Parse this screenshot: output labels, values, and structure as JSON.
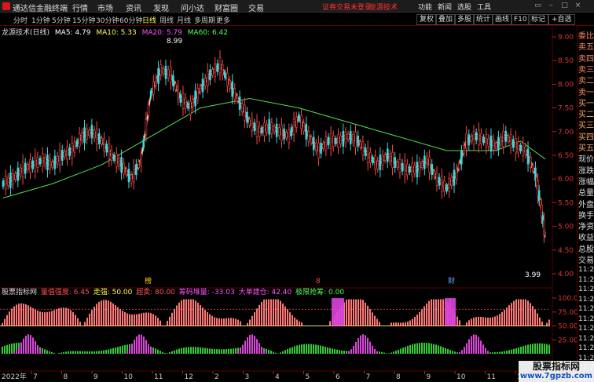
{
  "menu": {
    "app_title": "通达信金融终端",
    "items": [
      "行情",
      "市场",
      "资讯",
      "发现",
      "问小达",
      "财富圈",
      "交易"
    ],
    "login_status": "证券交易未登录",
    "brand_link": "龙源技术",
    "tools": [
      "功能",
      "新闻",
      "选股",
      "工具"
    ]
  },
  "periods": [
    "分时",
    "1分钟",
    "5分钟",
    "15分钟",
    "30分钟",
    "60分钟",
    "日线",
    "周线",
    "月线",
    "多周期",
    "更多"
  ],
  "active_period": "日线",
  "right_buttons": [
    "复权",
    "叠加",
    "多股",
    "统计",
    "画线",
    "F10",
    "标记",
    "+自选"
  ],
  "chart": {
    "stock_name": "龙源技术(日线)",
    "ma": [
      {
        "label": "MA5: 4.79",
        "color": "#ffffff"
      },
      {
        "label": "MA10: 5.33",
        "color": "#ffff55"
      },
      {
        "label": "MA20: 5.79",
        "color": "#ff55ff"
      },
      {
        "label": "MA60: 6.42",
        "color": "#55ff55"
      }
    ],
    "high_label": "8.99",
    "low_label": "3.99",
    "markers": [
      {
        "text": "榜",
        "color": "#ffcc00"
      },
      {
        "text": "8",
        "color": "#ff4444"
      },
      {
        "text": "财",
        "color": "#66aaff"
      }
    ],
    "year_label": "2022年"
  },
  "indicator": {
    "name": "股票指标网",
    "items": [
      {
        "label": "量值强度: 6.45",
        "color": "#ff5555"
      },
      {
        "label": "走强: 50.00",
        "color": "#ffff55"
      },
      {
        "label": "超卖: 80.00",
        "color": "#ff5555"
      },
      {
        "label": "筹码堆量: -33.03",
        "color": "#ff55ff"
      },
      {
        "label": "大单建仓: 42.40",
        "color": "#ff55ff"
      },
      {
        "label": "极限抢筹: 0.00",
        "color": "#55ff55"
      }
    ],
    "ticks": [
      "100.0",
      "75.00",
      "50.00",
      "25.00"
    ]
  },
  "side_panel": {
    "labels": [
      "委比",
      "卖五",
      "卖四",
      "卖三",
      "卖二",
      "卖一",
      "买一",
      "买二",
      "买三",
      "买四",
      "买五",
      "现价",
      "涨跌",
      "涨幅",
      "总量",
      "外盘",
      "换手",
      "净资",
      "收益",
      "总股",
      "交易"
    ],
    "times": [
      "11:2",
      "11:2",
      "11:2",
      "11:2",
      "11:2",
      "11:2",
      "11:2",
      "11:2",
      "11:2",
      "11:2",
      "11:2",
      "11:2"
    ]
  },
  "chart_data": {
    "type": "candlestick",
    "ylim": [
      3.9,
      9.1
    ],
    "y_ticks": [
      9.0,
      8.5,
      8.0,
      7.5,
      7.0,
      6.5,
      6.0,
      5.5,
      5.0,
      4.5,
      4.0
    ],
    "x_ticks": [
      "2022年",
      "7",
      "8",
      "9",
      "10",
      "11",
      "12",
      "2",
      "3",
      "4",
      "5",
      "6",
      "7",
      "8",
      "9",
      "10",
      "11",
      "12"
    ],
    "close_points": [
      [
        0,
        5.9
      ],
      [
        4,
        6.0
      ],
      [
        8,
        6.2
      ],
      [
        12,
        6.3
      ],
      [
        16,
        6.4
      ],
      [
        20,
        6.3
      ],
      [
        24,
        6.5
      ],
      [
        28,
        6.6
      ],
      [
        32,
        6.9
      ],
      [
        36,
        7.0
      ],
      [
        40,
        6.8
      ],
      [
        44,
        6.5
      ],
      [
        48,
        6.3
      ],
      [
        52,
        6.0
      ],
      [
        56,
        6.4
      ],
      [
        60,
        7.8
      ],
      [
        64,
        8.3
      ],
      [
        68,
        8.2
      ],
      [
        72,
        7.7
      ],
      [
        76,
        7.5
      ],
      [
        80,
        7.9
      ],
      [
        84,
        8.2
      ],
      [
        88,
        8.4
      ],
      [
        92,
        8.0
      ],
      [
        96,
        7.6
      ],
      [
        100,
        7.2
      ],
      [
        104,
        7.0
      ],
      [
        108,
        7.1
      ],
      [
        112,
        7.0
      ],
      [
        116,
        6.9
      ],
      [
        120,
        7.3
      ],
      [
        124,
        6.9
      ],
      [
        128,
        6.6
      ],
      [
        132,
        6.8
      ],
      [
        136,
        6.8
      ],
      [
        140,
        6.9
      ],
      [
        144,
        6.8
      ],
      [
        148,
        6.5
      ],
      [
        152,
        6.3
      ],
      [
        156,
        6.5
      ],
      [
        160,
        6.3
      ],
      [
        164,
        6.2
      ],
      [
        168,
        6.2
      ],
      [
        172,
        6.4
      ],
      [
        176,
        6.0
      ],
      [
        180,
        5.8
      ],
      [
        184,
        6.1
      ],
      [
        188,
        6.8
      ],
      [
        192,
        6.9
      ],
      [
        196,
        6.8
      ],
      [
        200,
        6.7
      ],
      [
        204,
        6.9
      ],
      [
        208,
        6.7
      ],
      [
        212,
        6.6
      ],
      [
        216,
        6.1
      ],
      [
        218,
        5.5
      ],
      [
        220,
        4.79
      ]
    ],
    "ma60_points": [
      [
        0,
        5.6
      ],
      [
        20,
        5.9
      ],
      [
        40,
        6.3
      ],
      [
        60,
        6.9
      ],
      [
        80,
        7.5
      ],
      [
        100,
        7.7
      ],
      [
        120,
        7.5
      ],
      [
        140,
        7.2
      ],
      [
        160,
        6.9
      ],
      [
        180,
        6.6
      ],
      [
        200,
        6.6
      ],
      [
        210,
        6.8
      ],
      [
        220,
        6.42
      ]
    ],
    "indicator_ylim": [
      0,
      110
    ]
  }
}
